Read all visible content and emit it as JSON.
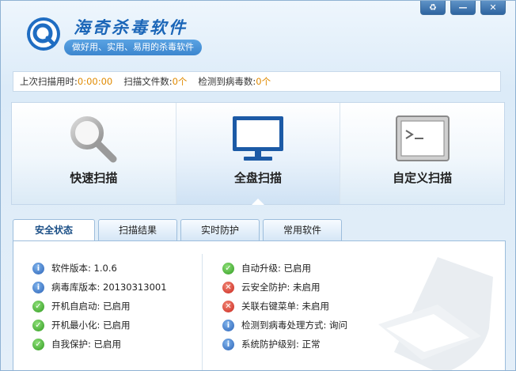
{
  "app": {
    "title": "海奇杀毒软件",
    "slogan": "做好用、实用、易用的杀毒软件",
    "window_buttons": [
      {
        "name": "skin-button",
        "icon": "recycle-icon",
        "glyph": "♻"
      },
      {
        "name": "minimize-button",
        "icon": "minimize-icon",
        "glyph": "—"
      },
      {
        "name": "close-button",
        "icon": "close-icon",
        "glyph": "✕"
      }
    ]
  },
  "stats": {
    "last_scan_label": "上次扫描用时:",
    "last_scan_value": "0:00:00",
    "files_label": "扫描文件数:",
    "files_value": "0个",
    "viruses_label": "检测到病毒数:",
    "viruses_value": "0个"
  },
  "scan_options": [
    {
      "label": "快速扫描",
      "icon": "magnifier-icon"
    },
    {
      "label": "全盘扫描",
      "icon": "monitor-icon",
      "selected": true
    },
    {
      "label": "自定义扫描",
      "icon": "terminal-icon"
    }
  ],
  "tabs": [
    {
      "label": "安全状态",
      "active": true
    },
    {
      "label": "扫描结果"
    },
    {
      "label": "实时防护"
    },
    {
      "label": "常用软件"
    }
  ],
  "status_left": [
    {
      "status": "info",
      "label": "软件版本:",
      "value": "1.0.6"
    },
    {
      "status": "info",
      "label": "病毒库版本:",
      "value": "20130313001"
    },
    {
      "status": "ok",
      "label": "开机自启动:",
      "value": "已启用"
    },
    {
      "status": "ok",
      "label": "开机最小化:",
      "value": "已启用"
    },
    {
      "status": "ok",
      "label": "自我保护:",
      "value": "已启用"
    }
  ],
  "status_right": [
    {
      "status": "ok",
      "label": "自动升级:",
      "value": "已启用"
    },
    {
      "status": "bad",
      "label": "云安全防护:",
      "value": "未启用"
    },
    {
      "status": "bad",
      "label": "关联右键菜单:",
      "value": "未启用"
    },
    {
      "status": "info",
      "label": "检测到病毒处理方式:",
      "value": "询问"
    },
    {
      "status": "info",
      "label": "系统防护级别:",
      "value": "正常"
    }
  ],
  "colors": {
    "accent": "#1b66b8",
    "stat_value": "#e08a00",
    "ok": "#2f9a1e",
    "bad": "#c9231a",
    "info": "#2b63b7"
  }
}
